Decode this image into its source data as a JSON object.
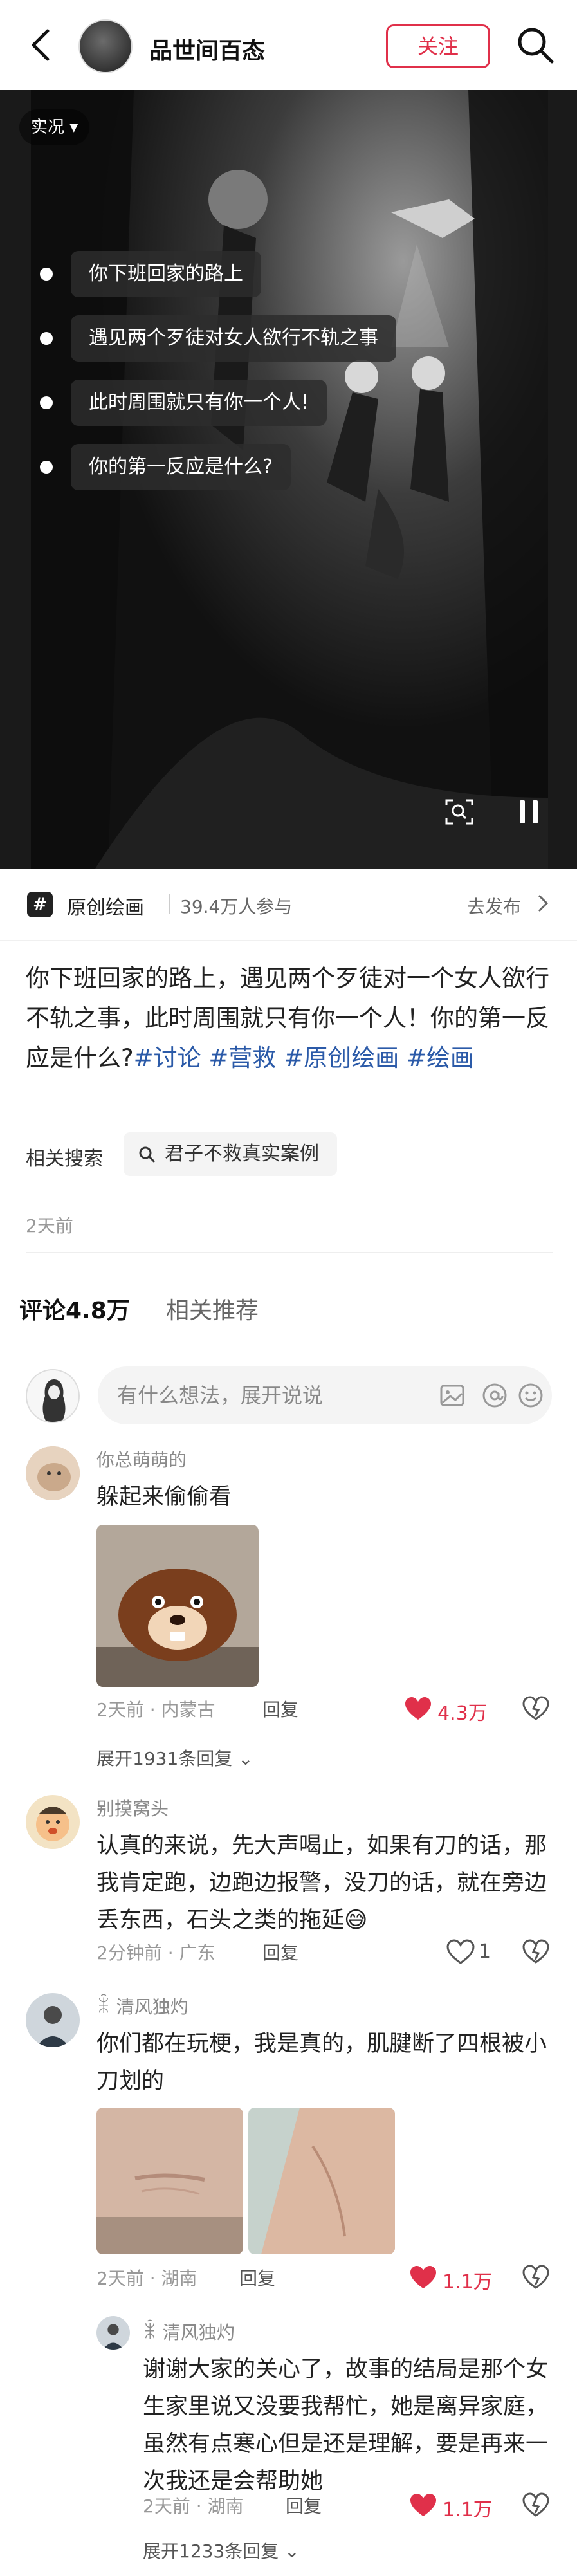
{
  "header": {
    "title": "品世间百态",
    "follow_label": "关注"
  },
  "media": {
    "live_label": "实况",
    "captions": [
      "你下班回家的路上",
      "遇见两个歹徒对女人欲行不轨之事",
      "此时周围就只有你一个人!",
      "你的第一反应是什么?"
    ]
  },
  "topic": {
    "name": "原创绘画",
    "participants": "39.4万人参与",
    "publish": "去发布"
  },
  "post": {
    "text": "你下班回家的路上，遇见两个歹徒对一个女人欲行不轨之事，此时周围就只有你一个人！你的第一反应是什么?",
    "tags": [
      "#讨论",
      "#营救",
      "#原创绘画",
      "#绘画"
    ],
    "related_label": "相关搜索",
    "related_query": "君子不救真实案例",
    "date": "2天前"
  },
  "tabs": {
    "comments": "评论4.8万",
    "related": "相关推荐"
  },
  "comment_input": {
    "placeholder": "有什么想法，展开说说"
  },
  "comments": [
    {
      "user": "你总萌萌的",
      "text": "躲起来偷偷看",
      "time": "2天前",
      "location": "内蒙古",
      "reply": "回复",
      "likes": "4.3万",
      "liked": true,
      "expand": "展开1931条回复"
    },
    {
      "user": "别摸窝头",
      "text": "认真的来说，先大声喝止，如果有刀的话，那我肯定跑，边跑边报警，没刀的话，就在旁边丢东西，石头之类的拖延",
      "time": "2分钟前",
      "location": "广东",
      "reply": "回复",
      "likes": "1",
      "liked": false
    },
    {
      "user": "清风独灼",
      "text": "你们都在玩梗，我是真的，肌腱断了四根被小刀划的",
      "time": "2天前",
      "location": "湖南",
      "reply": "回复",
      "likes": "1.1万",
      "liked": true
    },
    {
      "user": "清风独灼",
      "text": "谢谢大家的关心了，故事的结局是那个女生家里说又没要我帮忙，她是离异家庭，虽然有点寒心但是还是理解，要是再来一次我还是会帮助她",
      "time": "2天前",
      "location": "湖南",
      "reply": "回复",
      "likes": "1.1万",
      "liked": true,
      "expand": "展开1233条回复"
    }
  ],
  "colors": {
    "accent": "#e0304a",
    "tag": "#2b5aa8"
  }
}
